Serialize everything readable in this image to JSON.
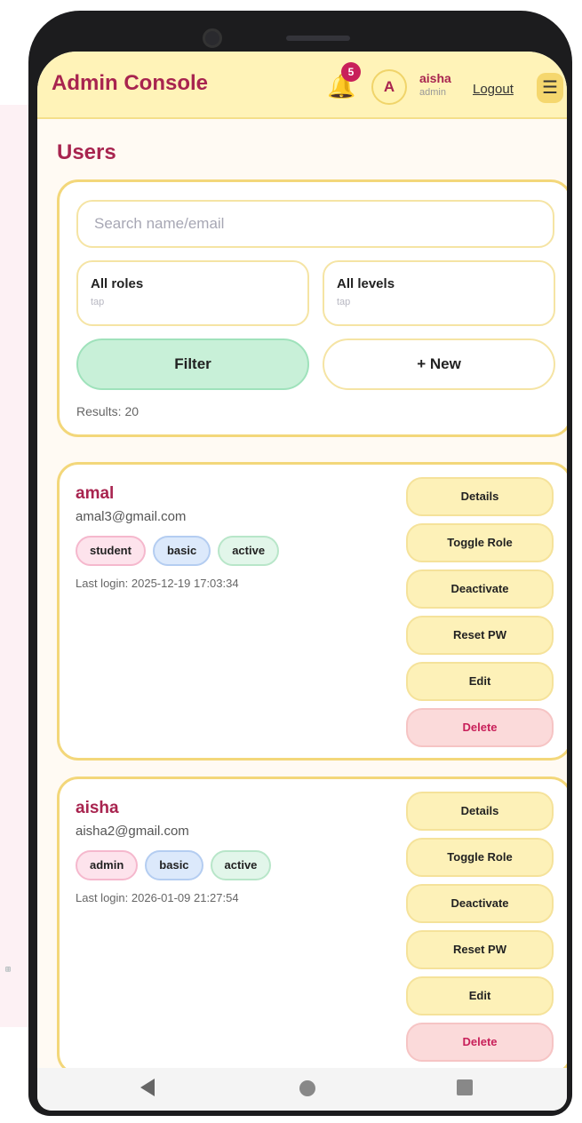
{
  "background": {
    "glyph": "⊞"
  },
  "header": {
    "title": "Admin Console",
    "notification_count": "5",
    "avatar_initial": "A",
    "user_name": "aisha",
    "user_role": "admin",
    "logout_label": "Logout",
    "menu_icon": "☰",
    "bell_icon": "🔔"
  },
  "page": {
    "title": "Users"
  },
  "filters": {
    "search_placeholder": "Search name/email",
    "role_select": {
      "label": "All roles",
      "hint": "tap"
    },
    "level_select": {
      "label": "All levels",
      "hint": "tap"
    },
    "filter_label": "Filter",
    "new_label": "+ New",
    "results_text": "Results: 20"
  },
  "users": [
    {
      "name": "amal",
      "email": "amal3@gmail.com",
      "tags": [
        "student",
        "basic",
        "active"
      ],
      "last_login": "Last login: 2025-12-19 17:03:34",
      "actions": [
        "Details",
        "Toggle Role",
        "Deactivate",
        "Reset PW",
        "Edit",
        "Delete"
      ]
    },
    {
      "name": "aisha",
      "email": "aisha2@gmail.com",
      "tags": [
        "admin",
        "basic",
        "active"
      ],
      "last_login": "Last login: 2026-01-09 21:27:54",
      "actions": [
        "Details",
        "Toggle Role",
        "Deactivate",
        "Reset PW",
        "Edit",
        "Delete"
      ]
    }
  ],
  "colors": {
    "accent": "#a8244f",
    "header_bg": "#fff3b8",
    "card_border": "#f3d77a",
    "filter_green": "#c8f0d8",
    "delete_red": "#fbdada"
  },
  "nav": {
    "back_icon": "back-triangle-icon",
    "home_icon": "home-circle-icon",
    "recent_icon": "recents-square-icon"
  }
}
